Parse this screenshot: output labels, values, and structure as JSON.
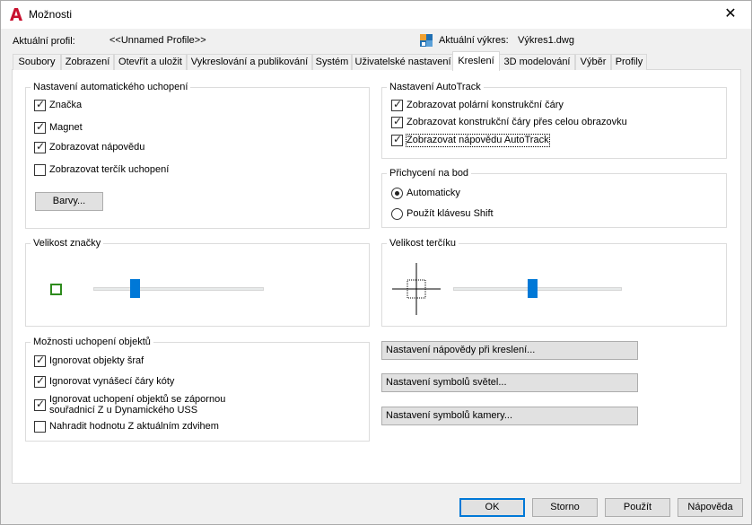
{
  "window": {
    "title": "Možnosti",
    "close_glyph": "✕"
  },
  "header": {
    "profile_label": "Aktuální profil:",
    "profile_value": "<<Unnamed Profile>>",
    "drawing_label": "Aktuální výkres:",
    "drawing_value": "Výkres1.dwg"
  },
  "tabs": [
    {
      "label": "Soubory"
    },
    {
      "label": "Zobrazení"
    },
    {
      "label": "Otevřít a uložit"
    },
    {
      "label": "Vykreslování a publikování"
    },
    {
      "label": "Systém"
    },
    {
      "label": "Uživatelské nastavení"
    },
    {
      "label": "Kreslení",
      "active": true
    },
    {
      "label": "3D modelování"
    },
    {
      "label": "Výběr"
    },
    {
      "label": "Profily"
    }
  ],
  "snap_settings": {
    "title": "Nastavení automatického uchopení",
    "options": [
      {
        "label": "Značka",
        "checked": true
      },
      {
        "label": "Magnet",
        "checked": true
      },
      {
        "label": "Zobrazovat nápovědu",
        "checked": true
      },
      {
        "label": "Zobrazovat terčík uchopení",
        "checked": false
      }
    ],
    "colors_button": "Barvy..."
  },
  "marker_size": {
    "title": "Velikost značky",
    "slider_value": 0.23
  },
  "object_snap": {
    "title": "Možnosti uchopení objektů",
    "options": [
      {
        "label": "Ignorovat objekty šraf",
        "checked": true
      },
      {
        "label": "Ignorovat vynášecí čáry kóty",
        "checked": true
      },
      {
        "label_line1": "Ignorovat uchopení objektů se zápornou",
        "label_line2": "souřadnicí Z u Dynamického USS",
        "checked": true
      },
      {
        "label": "Nahradit hodnotu Z aktuálním zdvihem",
        "checked": false
      }
    ]
  },
  "autotrack": {
    "title": "Nastavení AutoTrack",
    "options": [
      {
        "label": "Zobrazovat polární konstrukční čáry",
        "checked": true
      },
      {
        "label": "Zobrazovat konstrukční čáry přes celou obrazovku",
        "checked": true
      },
      {
        "label": "Zobrazovat nápovědu AutoTrack",
        "checked": true
      }
    ]
  },
  "point_snap": {
    "title": "Přichycení na bod",
    "options": [
      {
        "label": "Automaticky",
        "selected": true
      },
      {
        "label": "Použít klávesu Shift",
        "selected": false
      }
    ]
  },
  "aperture_size": {
    "title": "Velikost terčíku",
    "slider_value": 0.47
  },
  "side_buttons": {
    "drafting_tooltip": "Nastavení nápovědy při kreslení...",
    "light_glyphs": "Nastavení symbolů světel...",
    "camera_glyphs": "Nastavení symbolů kamery..."
  },
  "footer": {
    "ok": "OK",
    "cancel": "Storno",
    "apply": "Použít",
    "help": "Nápověda"
  },
  "colors": {
    "accent": "#0078d7",
    "marker": "#2e8b1d",
    "app_icon": "#c8102e"
  }
}
